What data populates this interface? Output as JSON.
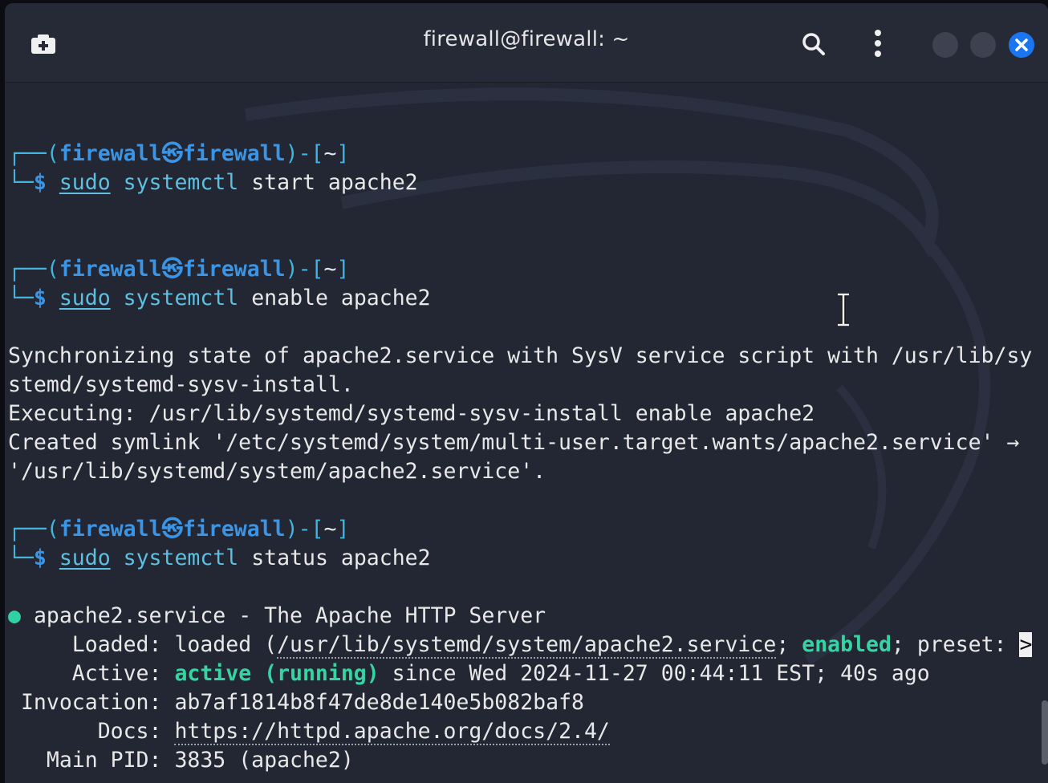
{
  "window": {
    "title": "firewall@firewall: ~",
    "accent": "#1a75f0"
  },
  "prompt": {
    "user": "firewall",
    "at": "㉿",
    "host": "firewall",
    "dir": "~"
  },
  "commands": [
    {
      "sudo": "sudo",
      "cmd": "systemctl",
      "args": "start apache2"
    },
    {
      "sudo": "sudo",
      "cmd": "systemctl",
      "args": "enable apache2"
    },
    {
      "sudo": "sudo",
      "cmd": "systemctl",
      "args": "status apache2"
    }
  ],
  "output": {
    "enable_lines": [
      "Synchronizing state of apache2.service with SysV service script with /usr/lib/sy",
      "stemd/systemd-sysv-install.",
      "Executing: /usr/lib/systemd/systemd-sysv-install enable apache2",
      "Created symlink '/etc/systemd/system/multi-user.target.wants/apache2.service' →",
      "'/usr/lib/systemd/system/apache2.service'."
    ],
    "status": {
      "bullet": "●",
      "header": "apache2.service - The Apache HTTP Server",
      "loaded_label": "Loaded:",
      "loaded_pre": "loaded (",
      "loaded_path": "/usr/lib/systemd/system/apache2.service",
      "loaded_sep": "; ",
      "loaded_enabled": "enabled",
      "loaded_post": "; preset: ",
      "truncation": ">",
      "active_label": "Active:",
      "active_state": "active (running)",
      "active_rest": " since Wed 2024-11-27 00:44:11 EST; 40s ago",
      "invocation_label": "Invocation:",
      "invocation_value": "ab7af1814b8f47de8de140e5b082baf8",
      "docs_label": "Docs:",
      "docs_value": "https://httpd.apache.org/docs/2.4/",
      "pid_label": "Main PID:",
      "pid_value": "3835 (apache2)"
    }
  },
  "icons": {
    "new_tab": "new-tab-icon",
    "search": "search-icon",
    "menu": "kebab-menu-icon",
    "close": "close-icon"
  }
}
